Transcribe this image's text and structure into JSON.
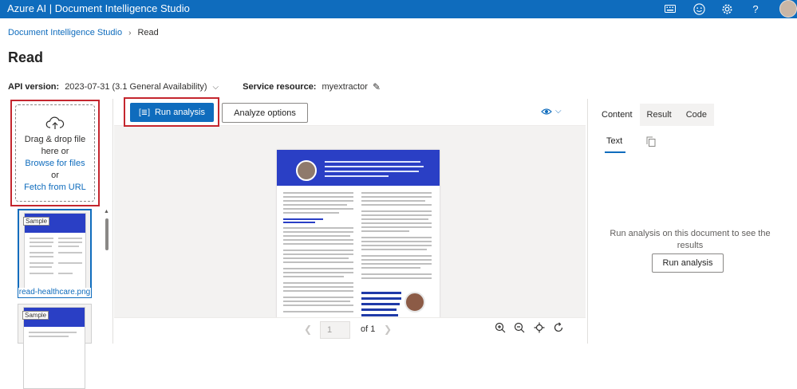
{
  "app": {
    "title": "Azure AI | Document Intelligence Studio"
  },
  "topbar_icons": [
    "keyboard-icon",
    "feedback-smile-icon",
    "settings-gear-icon",
    "help-icon",
    "avatar"
  ],
  "breadcrumb": {
    "root": "Document Intelligence Studio",
    "current": "Read"
  },
  "page": {
    "title": "Read"
  },
  "config": {
    "api_label": "API version:",
    "api_value": "2023-07-31 (3.1 General Availability)",
    "service_label": "Service resource:",
    "service_value": "myextractor"
  },
  "upload": {
    "drag_text_1": "Drag & drop file",
    "drag_text_2": "here or",
    "browse": "Browse for files",
    "or": "or",
    "fetch": "Fetch from URL"
  },
  "samples": [
    {
      "badge": "Sample",
      "name": "read-healthcare.png"
    },
    {
      "badge": "Sample",
      "name": ""
    }
  ],
  "toolbar": {
    "run_label": "Run analysis",
    "analyze_options_label": "Analyze options"
  },
  "pager": {
    "current": "1",
    "of_label": "of 1"
  },
  "results": {
    "tabs": [
      {
        "label": "Content"
      },
      {
        "label": "Result"
      },
      {
        "label": "Code"
      }
    ],
    "subtab": "Text",
    "message": "Run analysis on this document to see the results",
    "run_label": "Run analysis"
  },
  "colors": {
    "brand": "#0f6cbd",
    "highlight_border": "#c4262e"
  }
}
